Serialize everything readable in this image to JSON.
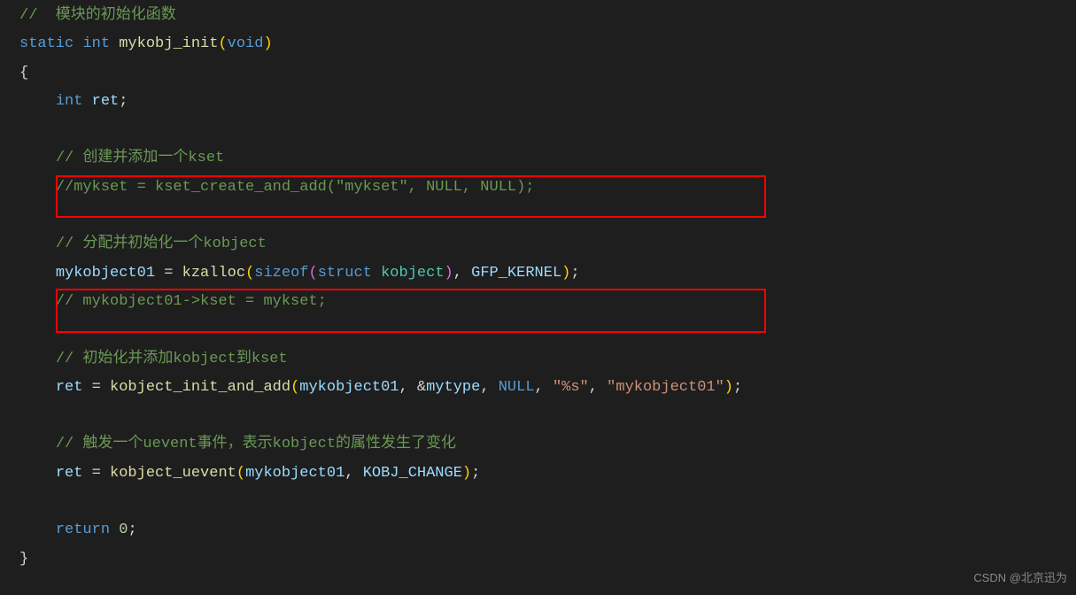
{
  "code": {
    "line1": "//  模块的初始化函数",
    "line2_static": "static",
    "line2_int": "int",
    "line2_func": "mykobj_init",
    "line2_void": "void",
    "line4_int": "int",
    "line4_ret": "ret",
    "line6": "// 创建并添加一个kset",
    "line7": "//mykset = kset_create_and_add(\"mykset\", NULL, NULL);",
    "line9": "// 分配并初始化一个kobject",
    "line10_var": "mykobject01",
    "line10_func": "kzalloc",
    "line10_sizeof": "sizeof",
    "line10_struct": "struct",
    "line10_kobject": "kobject",
    "line10_gfp": "GFP_KERNEL",
    "line11": "// mykobject01->kset = mykset;",
    "line13": "// 初始化并添加kobject到kset",
    "line14_ret": "ret",
    "line14_func": "kobject_init_and_add",
    "line14_arg1": "mykobject01",
    "line14_arg2": "mytype",
    "line14_null": "NULL",
    "line14_fmt": "\"%s\"",
    "line14_name": "\"mykobject01\"",
    "line16": "// 触发一个uevent事件，表示kobject的属性发生了变化",
    "line17_ret": "ret",
    "line17_func": "kobject_uevent",
    "line17_arg1": "mykobject01",
    "line17_arg2": "KOBJ_CHANGE",
    "line19_return": "return",
    "line19_zero": "0"
  },
  "watermark": "CSDN @北京迅为"
}
